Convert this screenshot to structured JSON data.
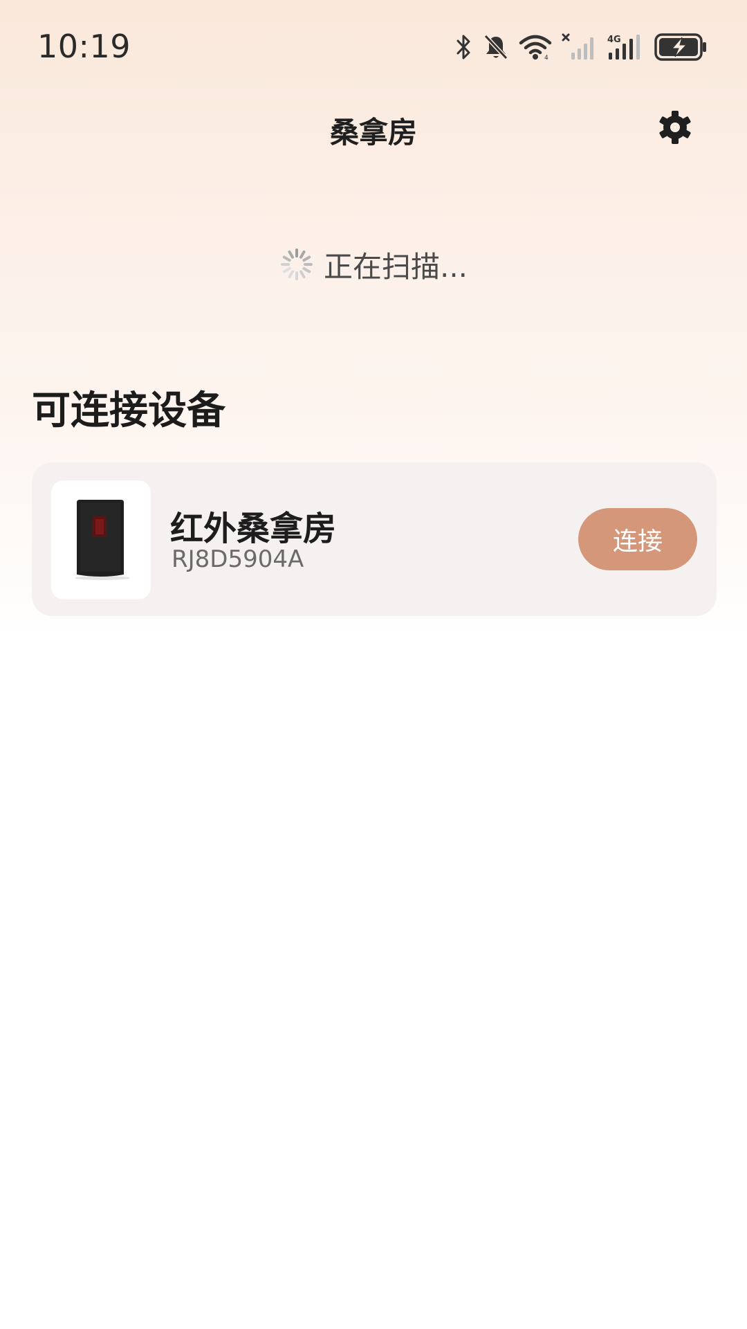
{
  "status_bar": {
    "time": "10:19",
    "icons": [
      "bluetooth-icon",
      "bell-muted-icon",
      "wifi-icon",
      "signal-no-service-icon",
      "signal-4g-icon",
      "battery-charging-icon"
    ],
    "network_label": "4G"
  },
  "header": {
    "title": "桑拿房",
    "settings_icon": "gear-icon"
  },
  "scan": {
    "status_text": "正在扫描..."
  },
  "devices_section": {
    "title": "可连接设备",
    "items": [
      {
        "name": "红外桑拿房",
        "id": "RJ8D5904A",
        "action_label": "连接"
      }
    ]
  },
  "colors": {
    "accent": "#d59779",
    "card_background": "#f5f1f0",
    "header_gradient_top": "#fae8da"
  }
}
